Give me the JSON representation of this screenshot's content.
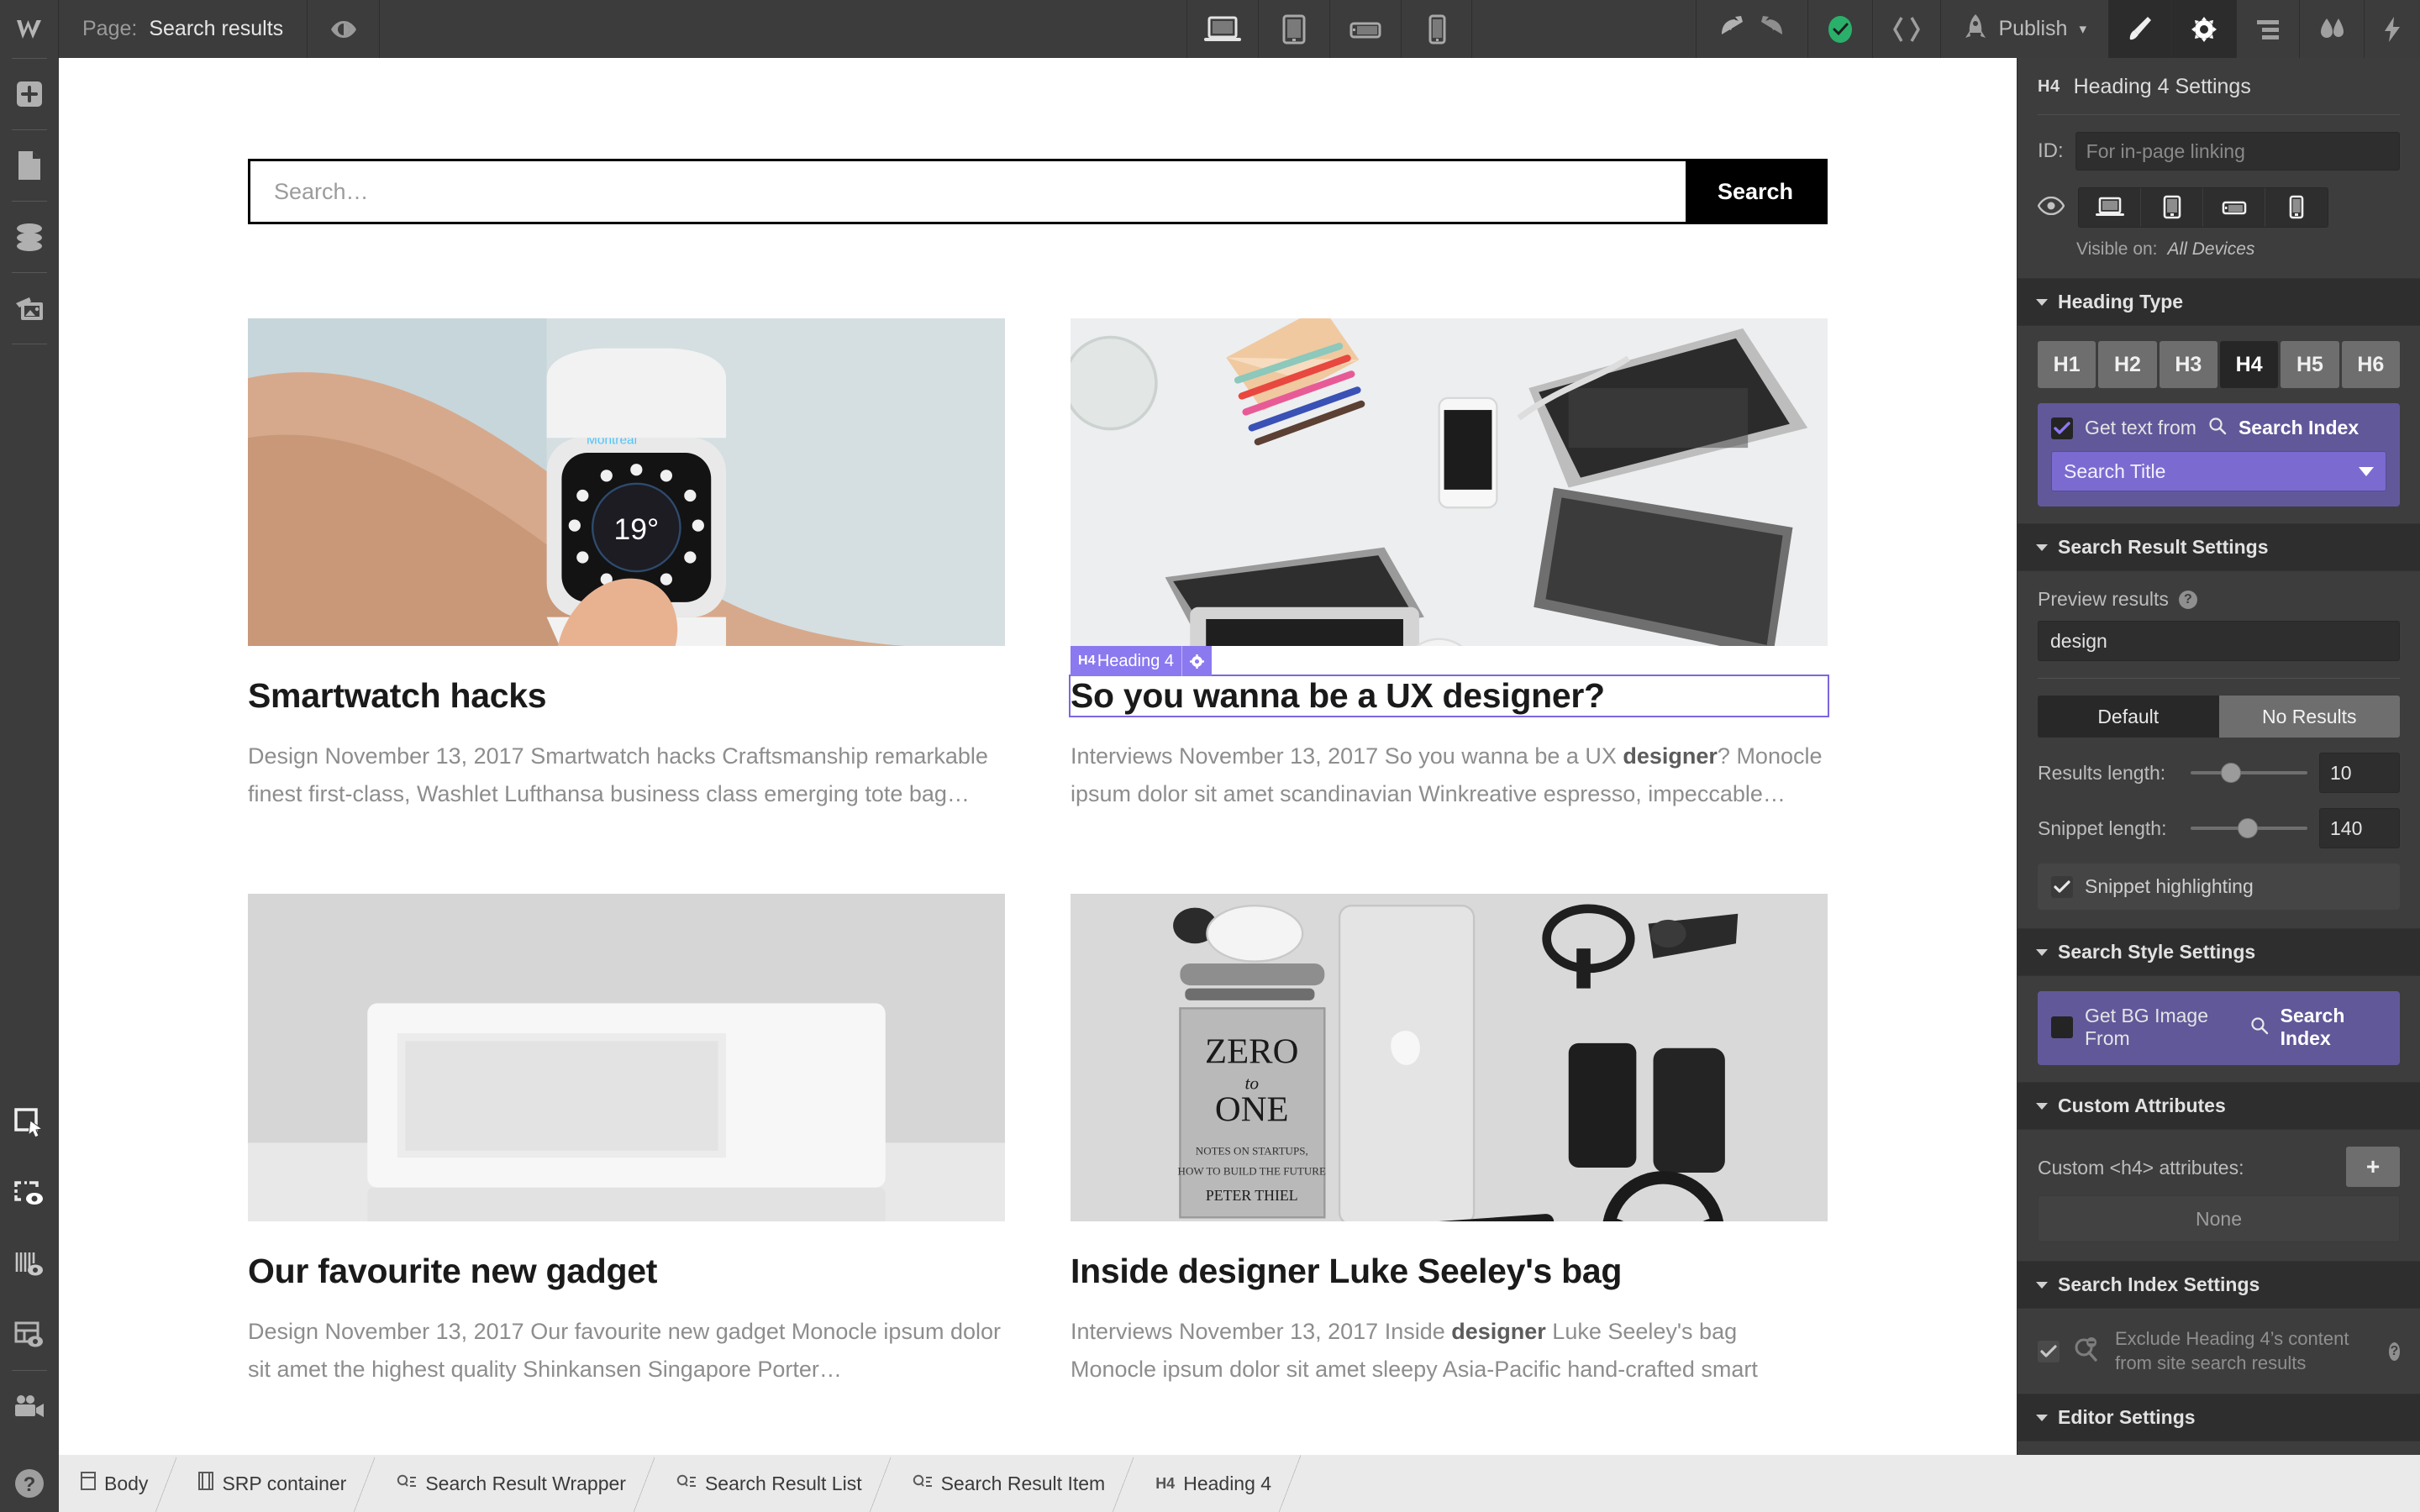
{
  "topbar": {
    "page_label": "Page:",
    "page_value": "Search results",
    "publish_label": "Publish",
    "icons": {
      "logo": "webflow-logo-icon",
      "preview_eye": "preview-eye-icon",
      "desktop": "desktop-device-icon",
      "tablet": "tablet-device-icon",
      "mobile_landscape": "mobile-landscape-device-icon",
      "mobile_portrait": "mobile-portrait-device-icon",
      "undo": "undo-icon",
      "redo": "redo-icon",
      "saved": "saved-check-icon",
      "code": "code-brackets-icon",
      "rocket": "rocket-icon",
      "style": "paintbrush-icon",
      "settings": "gear-icon",
      "navigator": "navigator-icon",
      "interactions": "interactions-icon",
      "flash": "lightning-icon"
    }
  },
  "leftrail": {
    "items": [
      {
        "name": "add-elements-icon"
      },
      {
        "name": "pages-icon"
      },
      {
        "name": "cms-database-icon"
      },
      {
        "name": "assets-icon"
      },
      {
        "name": "select-tool-icon"
      },
      {
        "name": "show-element-outlines-icon"
      },
      {
        "name": "show-grid-guides-icon"
      },
      {
        "name": "show-layout-guides-icon"
      },
      {
        "name": "video-tutorials-icon"
      },
      {
        "name": "help-icon"
      }
    ]
  },
  "canvas": {
    "search": {
      "placeholder": "Search…",
      "value": "",
      "button_label": "Search"
    },
    "results": [
      {
        "title": "Smartwatch hacks",
        "snippet_pre": "Design November 13, 2017 Smartwatch hacks Craftsmanship remarkable finest first-class, Washlet Lufthansa business class emerging tote bag…",
        "selected": false,
        "thumb": "smartwatch-photo"
      },
      {
        "title": "So you wanna be a UX designer?",
        "snippet_pre": "Interviews November 13, 2017 So you wanna be a UX ",
        "snippet_hl": "designer",
        "snippet_post": "? Monocle ipsum dolor sit amet scandinavian Winkreative espresso, impeccable…",
        "selected": true,
        "thumb": "desk-laptops-photo",
        "badge": {
          "tag": "H4",
          "name": "Heading 4",
          "gear": "gear-icon"
        }
      },
      {
        "title": "Our favourite new gadget",
        "snippet_pre": "Design November 13, 2017 Our favourite new gadget Monocle ipsum dolor sit amet the highest quality Shinkansen Singapore Porter…",
        "selected": false,
        "thumb": "white-speaker-photo"
      },
      {
        "title": "Inside designer Luke Seeley's bag",
        "snippet_pre": "Interviews November 13, 2017 Inside ",
        "snippet_hl": "designer",
        "snippet_post": " Luke Seeley's bag Monocle ipsum dolor sit amet sleepy Asia-Pacific hand-crafted smart",
        "selected": false,
        "thumb": "flatlay-gear-photo"
      }
    ]
  },
  "rightpanel": {
    "header": {
      "tag": "H4",
      "title": "Heading 4 Settings"
    },
    "id_field": {
      "label": "ID:",
      "placeholder": "For in-page linking",
      "value": ""
    },
    "visibility": {
      "eye_icon": "eye-icon",
      "visible_label": "Visible on:",
      "visible_value": "All Devices"
    },
    "heading_type": {
      "section_title": "Heading Type",
      "options": [
        "H1",
        "H2",
        "H3",
        "H4",
        "H5",
        "H6"
      ],
      "selected": "H4",
      "get_text_from": {
        "checked": true,
        "label": "Get text from",
        "source_icon": "search-icon",
        "source": "Search Index",
        "select_value": "Search Title"
      }
    },
    "search_result_settings": {
      "section_title": "Search Result Settings",
      "preview_label": "Preview results",
      "preview_help_icon": "help-icon",
      "preview_value": "design",
      "tabs": [
        "Default",
        "No Results"
      ],
      "tab_selected": "Default",
      "results_length_label": "Results length:",
      "results_length_value": "10",
      "snippet_length_label": "Snippet length:",
      "snippet_length_value": "140",
      "snippet_highlighting": {
        "label": "Snippet highlighting",
        "checked": true
      }
    },
    "search_style_settings": {
      "section_title": "Search Style Settings",
      "get_bg": {
        "checked": false,
        "label": "Get BG Image From",
        "source_icon": "search-icon",
        "source": "Search Index"
      }
    },
    "custom_attributes": {
      "section_title": "Custom Attributes",
      "label": "Custom <h4> attributes:",
      "add_icon": "plus-icon",
      "empty_value": "None"
    },
    "search_index_settings": {
      "section_title": "Search Index Settings",
      "exclude": {
        "checked": true,
        "icon": "search-exclude-icon",
        "label": "Exclude Heading 4’s content from site search results",
        "help_icon": "help-icon"
      }
    },
    "editor_settings": {
      "section_title": "Editor Settings"
    }
  },
  "breadcrumb": {
    "help_icon": "help-icon",
    "items": [
      {
        "tag": "body-icon",
        "label": "Body"
      },
      {
        "tag": "container-icon",
        "label": "SRP container"
      },
      {
        "tag": "search-icon",
        "label": "Search Result Wrapper"
      },
      {
        "tag": "search-icon",
        "label": "Search Result List"
      },
      {
        "tag": "search-icon",
        "label": "Search Result Item"
      },
      {
        "tag": "H4",
        "label": "Heading 4"
      }
    ]
  },
  "colors": {
    "panel_bg": "#3d3d3d",
    "accent_purple": "#8b79f0",
    "purple_box": "#61589a",
    "select_purple": "#7b6bd0",
    "publish_green": "#2ab06a"
  }
}
